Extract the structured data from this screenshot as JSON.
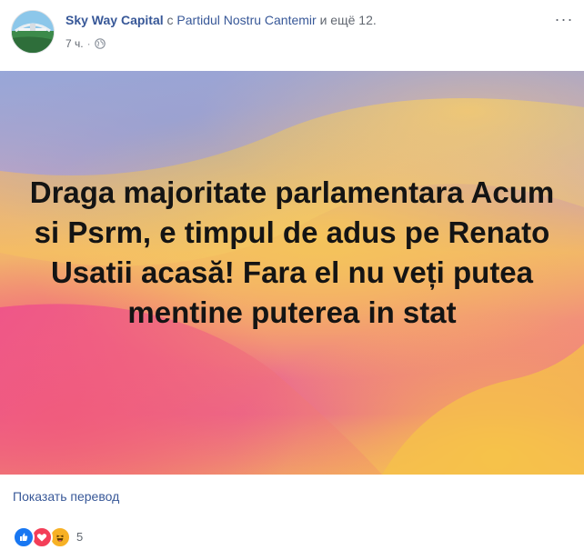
{
  "post": {
    "author": "Sky Way Capital",
    "with_text": "с",
    "tagged_page": "Partidul Nostru Cantemir",
    "and_more": "и ещё 12.",
    "time": "7 ч.",
    "dot": "·",
    "privacy_icon": "globe-icon",
    "more_icon": "more-options-icon",
    "more_glyph": "···",
    "text": "Draga majoritate parlamentara Acum si Psrm, e timpul de adus pe Renato Usatii acasă! Fara el nu veți putea mentine puterea in stat",
    "translate_label": "Показать перевод",
    "reactions": {
      "icons": [
        "like-icon",
        "love-icon",
        "haha-icon"
      ],
      "count": "5"
    }
  },
  "colors": {
    "link": "#385898",
    "text": "#1d2129",
    "meta": "#616770",
    "like": "#1877f2",
    "love": "#f33e58",
    "haha": "#f7b125"
  }
}
